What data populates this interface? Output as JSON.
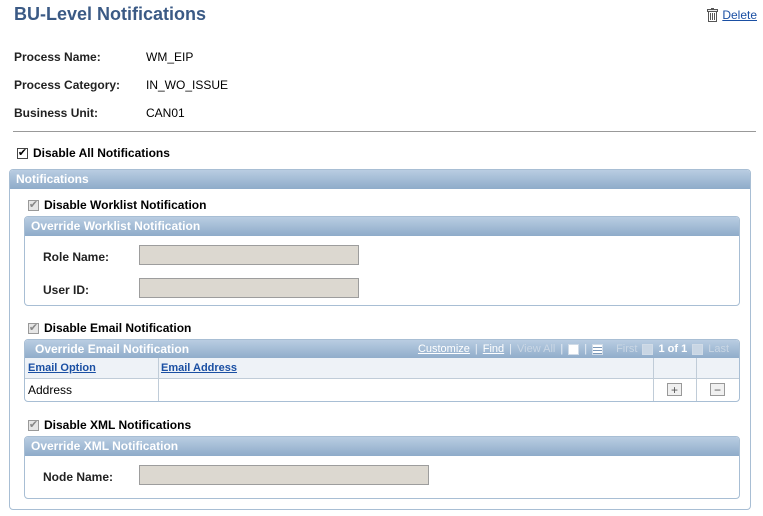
{
  "page": {
    "title": "BU-Level Notifications",
    "delete_label": "Delete"
  },
  "fields": {
    "process_name": {
      "label": "Process Name:",
      "value": "WM_EIP"
    },
    "process_category": {
      "label": "Process Category:",
      "value": "IN_WO_ISSUE"
    },
    "business_unit": {
      "label": "Business Unit:",
      "value": "CAN01"
    }
  },
  "disable_all": {
    "label": "Disable All Notifications",
    "checked": true
  },
  "notifications": {
    "title": "Notifications",
    "worklist": {
      "checkbox_label": "Disable Worklist Notification",
      "override_title": "Override Worklist Notification",
      "role_label": "Role Name:",
      "role_value": "",
      "user_label": "User ID:",
      "user_value": ""
    },
    "email": {
      "checkbox_label": "Disable Email Notification",
      "override_title": "Override Email Notification",
      "tools": {
        "customize": "Customize",
        "find": "Find",
        "view_all": "View All",
        "first": "First",
        "position": "1 of 1",
        "last": "Last"
      },
      "columns": [
        "Email Option",
        "Email Address"
      ],
      "rows": [
        {
          "option": "Address",
          "address": ""
        }
      ]
    },
    "xml": {
      "checkbox_label": "Disable XML Notifications",
      "override_title": "Override XML Notification",
      "node_label": "Node Name:",
      "node_value": ""
    }
  }
}
